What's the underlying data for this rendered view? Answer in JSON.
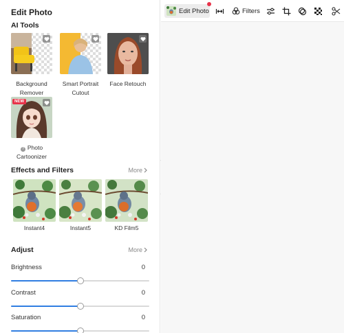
{
  "panel": {
    "title": "Edit Photo",
    "ai_tools": {
      "title": "AI Tools",
      "items": [
        {
          "label": "Background Remover",
          "new": false
        },
        {
          "label": "Smart Portrait Cutout",
          "new": false
        },
        {
          "label": "Face Retouch",
          "new": false
        },
        {
          "label": "Photo Cartoonizer",
          "new": true,
          "badge": "NEW"
        }
      ]
    },
    "effects": {
      "title": "Effects and Filters",
      "more": "More",
      "items": [
        {
          "label": "Instant4"
        },
        {
          "label": "Instant5"
        },
        {
          "label": "KD Film5"
        }
      ]
    },
    "adjust": {
      "title": "Adjust",
      "more": "More",
      "sliders": [
        {
          "label": "Brightness",
          "value": "0",
          "level": 0.5
        },
        {
          "label": "Contrast",
          "value": "0",
          "level": 0.5
        },
        {
          "label": "Saturation",
          "value": "0",
          "level": 0.5
        }
      ]
    }
  },
  "toolbar": {
    "edit_photo": "Edit Photo",
    "filters": "Filters",
    "icons": [
      "resize-icon",
      "filters-icon",
      "adjust-sliders-icon",
      "crop-icon",
      "overlay-icon",
      "mosaic-icon",
      "cutout-icon"
    ]
  },
  "colors": {
    "accent": "#2f7de1",
    "badge": "#e8334a",
    "canvas": "#f7f7f7"
  }
}
